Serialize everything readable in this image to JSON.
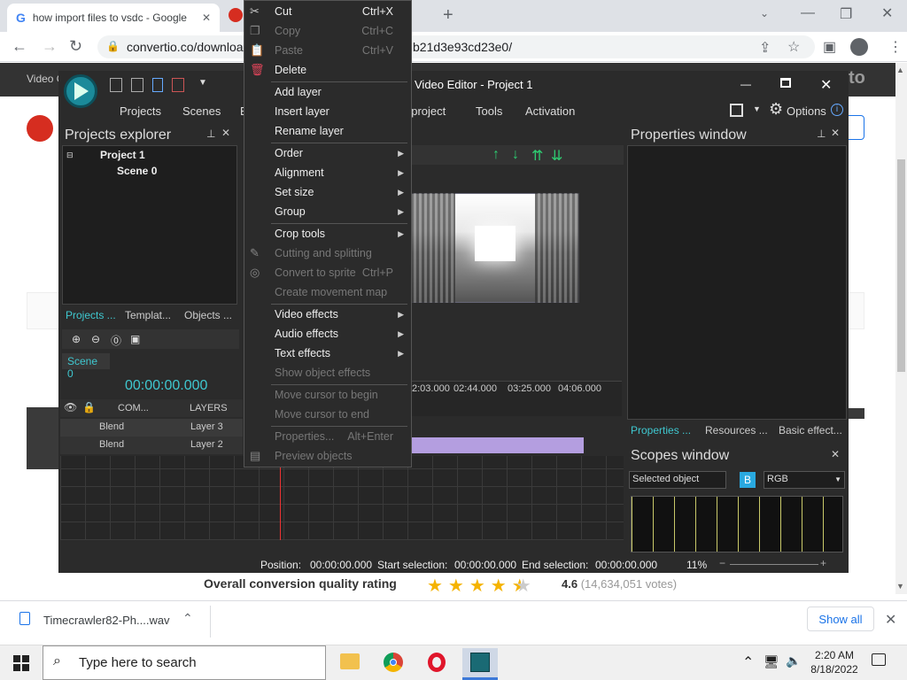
{
  "browser": {
    "tab_active": "how import files to vsdc - Google",
    "url_left": "convertio.co/downloa",
    "url_right": "b21d3e93cd23e0/"
  },
  "site": {
    "nav_label": "Video C",
    "logo_text": "to",
    "rating_label": "Overall conversion quality rating",
    "rating_value": "4.6",
    "rating_votes": "(14,634,051 votes)",
    "rating_stars": 4.5
  },
  "downloads": {
    "file_name": "Timecrawler82-Ph....wav",
    "show_all": "Show all"
  },
  "taskbar": {
    "search_placeholder": "Type here to search",
    "time": "2:20 AM",
    "date": "8/18/2022"
  },
  "app": {
    "title": "Video Editor - Project 1",
    "menu": [
      "Projects",
      "Scenes",
      "E",
      "t project",
      "Tools",
      "Activation"
    ],
    "options_label": "Options",
    "projects_explorer": "Projects explorer",
    "project_name": "Project 1",
    "scene_name": "Scene 0",
    "left_tabs": [
      "Projects ...",
      "Templat...",
      "Objects ..."
    ],
    "scene_tab": "Scene 0",
    "timecode": "00:00:00.000",
    "track_header_com": "COM...",
    "track_header_layers": "LAYERS",
    "tracks": [
      {
        "blend": "Blend",
        "name": "Layer 3"
      },
      {
        "blend": "Blend",
        "name": "Layer 2"
      }
    ],
    "ruler": [
      "2:03.000",
      "02:44.000",
      "03:25.000",
      "04:06.000"
    ],
    "properties_window": "Properties window",
    "right_tabs": [
      "Properties ...",
      "Resources ...",
      "Basic effect..."
    ],
    "scopes_window": "Scopes window",
    "scope_select": "Selected object",
    "scope_b": "B",
    "scope_mode": "RGB",
    "status": {
      "position_label": "Position:",
      "position": "00:00:00.000",
      "start_label": "Start selection:",
      "start": "00:00:00.000",
      "end_label": "End selection:",
      "end": "00:00:00.000",
      "zoom": "11%"
    }
  },
  "context_menu": {
    "items": [
      {
        "label": "Cut",
        "key": "Ctrl+X",
        "disabled": false,
        "icon": "scissors-icon"
      },
      {
        "label": "Copy",
        "key": "Ctrl+C",
        "disabled": true,
        "icon": "copy-icon"
      },
      {
        "label": "Paste",
        "key": "Ctrl+V",
        "disabled": true,
        "icon": "paste-icon"
      },
      {
        "label": "Delete",
        "key": "",
        "disabled": false,
        "icon": "delete-icon"
      },
      {
        "label": "Add layer",
        "key": "",
        "disabled": false
      },
      {
        "label": "Insert layer",
        "key": "",
        "disabled": false
      },
      {
        "label": "Rename layer",
        "key": "",
        "disabled": false
      },
      {
        "label": "Order",
        "submenu": true
      },
      {
        "label": "Alignment",
        "submenu": true
      },
      {
        "label": "Set size",
        "submenu": true
      },
      {
        "label": "Group",
        "submenu": true
      },
      {
        "label": "Crop tools",
        "submenu": true
      },
      {
        "label": "Cutting and splitting",
        "disabled": true,
        "icon": "pen-icon"
      },
      {
        "label": "Convert to sprite",
        "key": "Ctrl+P",
        "disabled": true,
        "icon": "sprite-icon"
      },
      {
        "label": "Create movement map",
        "disabled": true
      },
      {
        "label": "Video effects",
        "submenu": true
      },
      {
        "label": "Audio effects",
        "submenu": true
      },
      {
        "label": "Text effects",
        "submenu": true
      },
      {
        "label": "Show object effects",
        "disabled": true
      },
      {
        "label": "Move cursor to begin",
        "disabled": true
      },
      {
        "label": "Move cursor to end",
        "disabled": true
      },
      {
        "label": "Properties...",
        "key": "Alt+Enter",
        "disabled": true
      },
      {
        "label": "Preview objects",
        "disabled": true,
        "icon": "preview-icon"
      }
    ]
  }
}
